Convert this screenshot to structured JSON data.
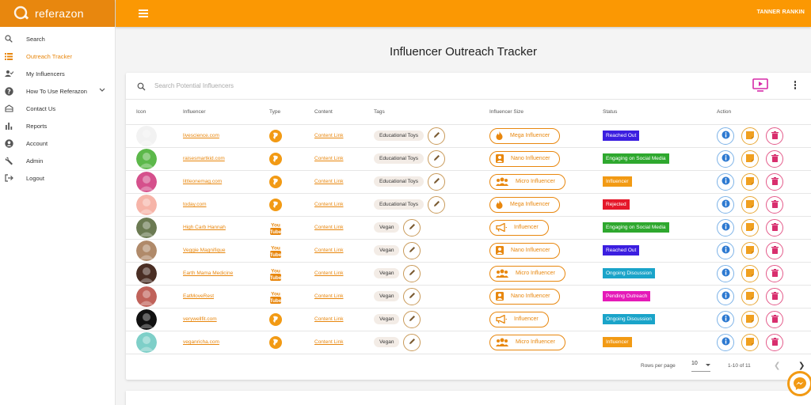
{
  "app": {
    "name": "referazon",
    "user": "TANNER RANKIN"
  },
  "colors": {
    "brand": "#fb9803",
    "brand_dark": "#e8870e"
  },
  "sidebar": {
    "items": [
      {
        "label": "Search",
        "icon": "search-icon",
        "active": false
      },
      {
        "label": "Outreach Tracker",
        "icon": "list-icon",
        "active": true
      },
      {
        "label": "My Influencers",
        "icon": "people-icon",
        "active": false
      },
      {
        "label": "How To Use Referazon",
        "icon": "help-icon",
        "active": false,
        "expandable": true
      },
      {
        "label": "Contact Us",
        "icon": "inbox-icon",
        "active": false
      },
      {
        "label": "Reports",
        "icon": "bar-chart-icon",
        "active": false
      },
      {
        "label": "Account",
        "icon": "account-icon",
        "active": false
      },
      {
        "label": "Admin",
        "icon": "wrench-icon",
        "active": false
      },
      {
        "label": "Logout",
        "icon": "logout-icon",
        "active": false
      }
    ]
  },
  "page": {
    "title": "Influencer Outreach Tracker"
  },
  "search": {
    "placeholder": "Search Potential Influencers",
    "value": ""
  },
  "table": {
    "columns": [
      "Icon",
      "Influencer",
      "Type",
      "Content",
      "Tags",
      "Influencer Size",
      "Status",
      "Action"
    ],
    "rows": [
      {
        "avatar_color": "#f2f2f2",
        "influencer": "livescience.com",
        "type": "website",
        "content": "Content Link",
        "tag": "Educational Toys",
        "size": "Mega Influencer",
        "size_icon": "flame-icon",
        "status": "Reached Out",
        "status_color": "#3b1ee0"
      },
      {
        "avatar_color": "#5cb84a",
        "influencer": "raisesmartkid.com",
        "type": "website",
        "content": "Content Link",
        "tag": "Educational Toys",
        "size": "Nano Influencer",
        "size_icon": "person-icon",
        "status": "Engaging on Social Media",
        "status_color": "#2ea82e"
      },
      {
        "avatar_color": "#d5508c",
        "influencer": "littleonemag.com",
        "type": "website",
        "content": "Content Link",
        "tag": "Educational Toys",
        "size": "Micro Influencer",
        "size_icon": "group-icon",
        "status": "Influencer",
        "status_color": "#f29a14"
      },
      {
        "avatar_color": "#f6b4a8",
        "influencer": "today.com",
        "type": "website",
        "content": "Content Link",
        "tag": "Educational Toys",
        "size": "Mega Influencer",
        "size_icon": "flame-icon",
        "status": "Rejected",
        "status_color": "#e5182a"
      },
      {
        "avatar_color": "#6b7a52",
        "influencer": "High Carb Hannah",
        "type": "youtube",
        "content": "Content Link",
        "tag": "Vegan",
        "size": "Influencer",
        "size_icon": "megaphone-icon",
        "status": "Engaging on Social Media",
        "status_color": "#2ea82e"
      },
      {
        "avatar_color": "#b08a6a",
        "influencer": "Veggie Magnifique",
        "type": "youtube",
        "content": "Content Link",
        "tag": "Vegan",
        "size": "Nano Influencer",
        "size_icon": "person-icon",
        "status": "Reached Out",
        "status_color": "#3b1ee0"
      },
      {
        "avatar_color": "#4a2e24",
        "influencer": "Earth Mama Medicine",
        "type": "youtube",
        "content": "Content Link",
        "tag": "Vegan",
        "size": "Micro Influencer",
        "size_icon": "group-icon",
        "status": "Ongoing Discussion",
        "status_color": "#1aa4c9"
      },
      {
        "avatar_color": "#c0625a",
        "influencer": "EatMoveRest",
        "type": "youtube",
        "content": "Content Link",
        "tag": "Vegan",
        "size": "Nano Influencer",
        "size_icon": "person-icon",
        "status": "Pending Outreach",
        "status_color": "#e51ab8"
      },
      {
        "avatar_color": "#111111",
        "influencer": "verywellfit.com",
        "type": "website",
        "content": "Content Link",
        "tag": "Vegan",
        "size": "Influencer",
        "size_icon": "megaphone-icon",
        "status": "Ongoing Discussion",
        "status_color": "#1aa4c9"
      },
      {
        "avatar_color": "#7ecfc8",
        "influencer": "veganricha.com",
        "type": "website",
        "content": "Content Link",
        "tag": "Vegan",
        "size": "Micro Influencer",
        "size_icon": "group-icon",
        "status": "Influencer",
        "status_color": "#f29a14"
      }
    ]
  },
  "pagination": {
    "rows_label": "Rows per page",
    "rows_value": "10",
    "range": "1-10 of 11"
  }
}
